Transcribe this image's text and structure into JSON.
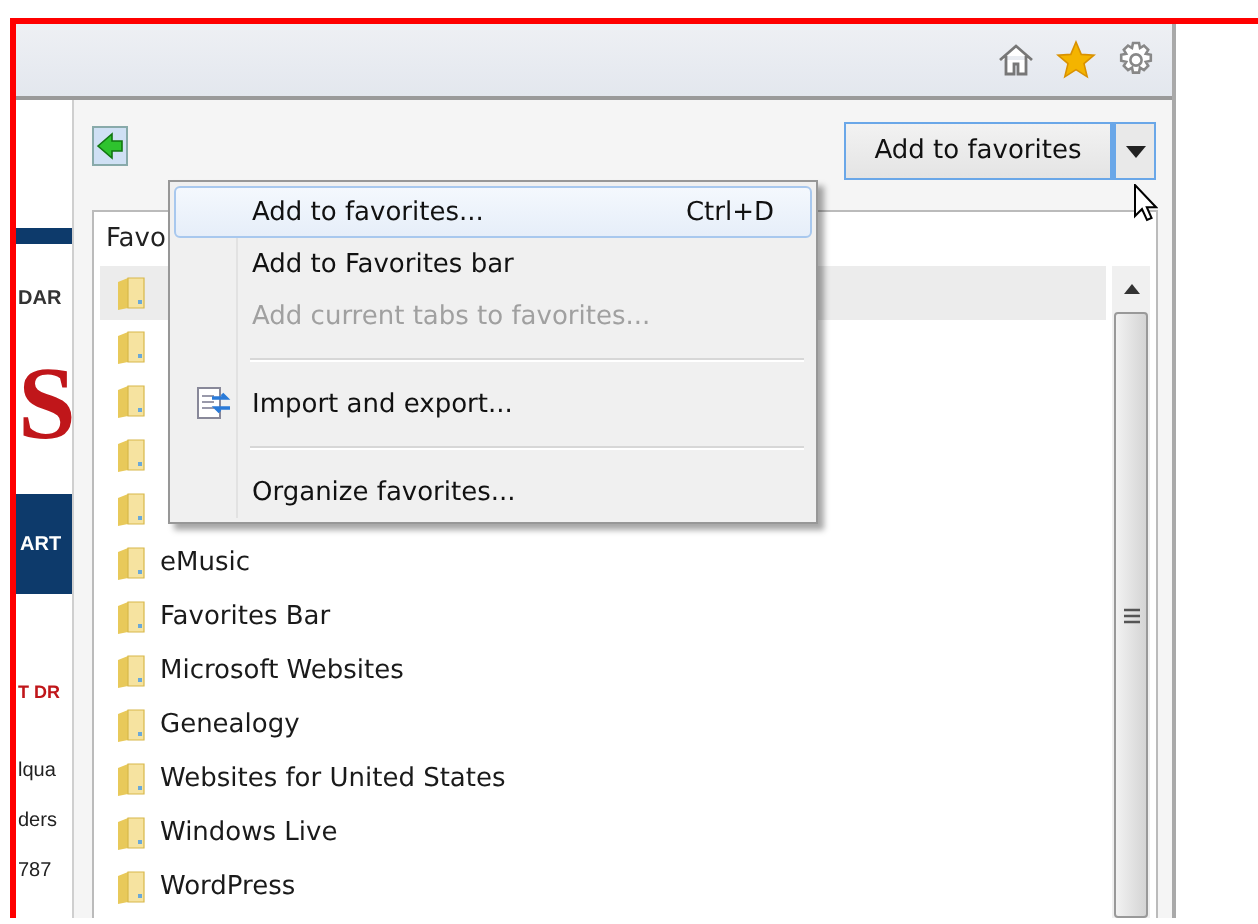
{
  "webpage_strip": [
    {
      "kind": "caps",
      "text": "DAR"
    },
    {
      "kind": "logo",
      "text": "S"
    },
    {
      "kind": "banner",
      "text": "ART"
    },
    {
      "kind": "headline",
      "text": "T DR"
    },
    {
      "kind": "body",
      "text": "lqua"
    },
    {
      "kind": "body",
      "text": "ders"
    },
    {
      "kind": "body",
      "text": "787"
    }
  ],
  "panel": {
    "add_button": "Add to favorites",
    "list_tab": "Favo",
    "items": [
      {
        "selected": true
      },
      {
        "selected": false
      },
      {
        "selected": false
      },
      {
        "selected": false
      },
      {
        "selected": false
      },
      {
        "name": "eMusic",
        "selected": false
      },
      {
        "name": "Favorites Bar",
        "selected": false
      },
      {
        "name": "Microsoft Websites",
        "selected": false
      },
      {
        "name": "Genealogy",
        "selected": false
      },
      {
        "name": "Websites for United States",
        "selected": false
      },
      {
        "name": "Windows Live",
        "selected": false
      },
      {
        "name": "WordPress",
        "selected": false
      }
    ]
  },
  "menu": [
    {
      "kind": "command",
      "label": "Add to favorites...",
      "shortcut": "Ctrl+D",
      "selected": true,
      "disabled": false
    },
    {
      "kind": "command",
      "label": "Add to Favorites bar",
      "selected": false,
      "disabled": false
    },
    {
      "kind": "command",
      "label": "Add current tabs to favorites...",
      "selected": false,
      "disabled": true
    },
    {
      "kind": "separator"
    },
    {
      "kind": "icon-command",
      "label": "Import and export...",
      "selected": false,
      "disabled": false
    },
    {
      "kind": "separator"
    },
    {
      "kind": "command",
      "label": "Organize favorites...",
      "selected": false,
      "disabled": false
    }
  ]
}
